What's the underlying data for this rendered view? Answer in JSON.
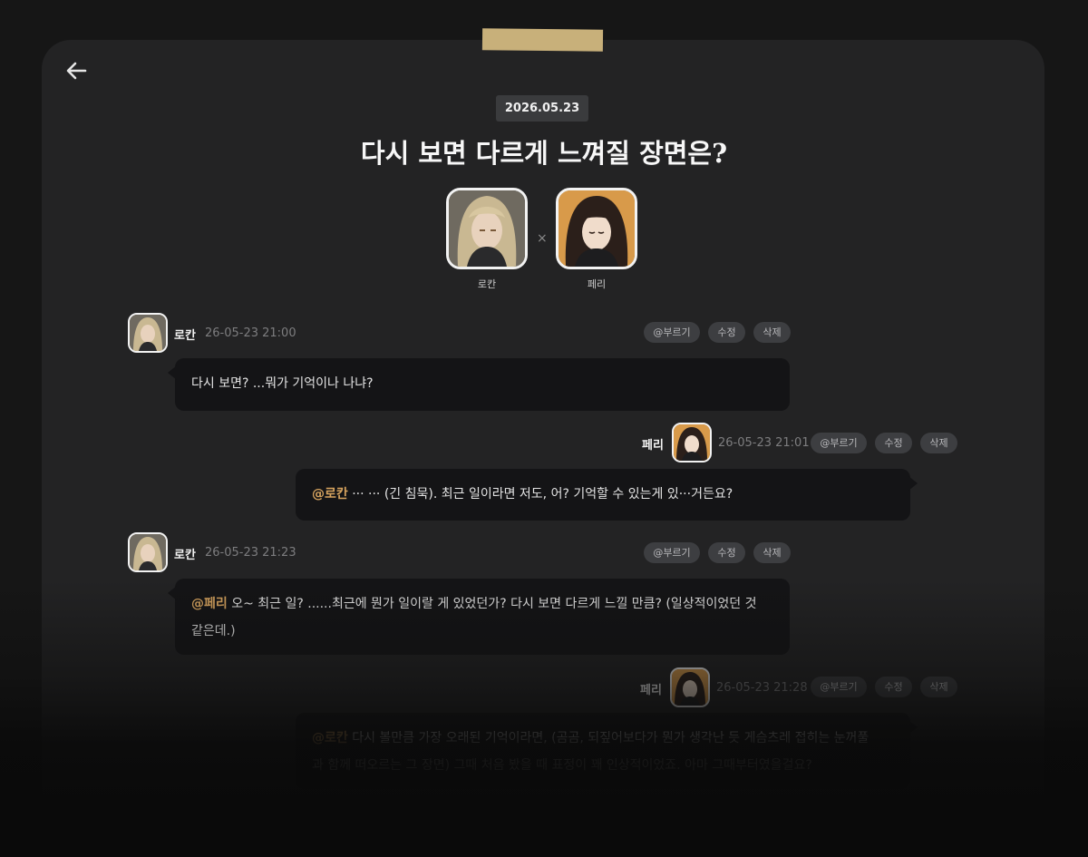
{
  "header": {
    "date": "2026.05.23",
    "title": "다시 보면 다르게 느껴질 장면은?"
  },
  "characters": [
    {
      "name": "로칸",
      "icon": "rokan-portrait"
    },
    {
      "name": "페리",
      "icon": "peri-portrait"
    }
  ],
  "separator": "×",
  "actions": {
    "call": "@부르기",
    "edit": "수정",
    "delete": "삭제"
  },
  "messages": [
    {
      "author": "로칸",
      "time": "26-05-23 21:00",
      "side": "left",
      "mention": "",
      "text": "다시 보면? ...뭐가 기억이나 나냐?"
    },
    {
      "author": "페리",
      "time": "26-05-23 21:01",
      "side": "right",
      "mention": "@로칸",
      "text": " ··· ··· (긴 침묵). 최근 일이라면 저도, 어? 기억할 수 있는게 있···거든요?"
    },
    {
      "author": "로칸",
      "time": "26-05-23 21:23",
      "side": "left",
      "mention": "@페리",
      "text_line1": " 오~ 최근 일? ......최근에 뭔가 일이랄 게 있었던가? 다시 보면 다르게 느낄 만큼? (일상적이었던 것",
      "text_line2": "같은데.)"
    },
    {
      "author": "페리",
      "time": "26-05-23 21:28",
      "side": "right",
      "mention": "@로칸",
      "text_line1": " 다시 볼만큼 가장 오래된 기억이라면, (곰곰, 되짚어보다가 뭔가 생각난 듯 게슴츠레 접히는 눈꺼풀",
      "text_line2": "과 함께 떠오르는 그 장면) 그때 처음 봤을 때 표정이 꽤 인상적이었죠. 아마 그때부터였을걸요?"
    }
  ],
  "colors": {
    "card": "#232324",
    "bubble": "#141416",
    "mention": "#d7a45f",
    "tape": "#c8b07a",
    "pill": "#3d3e41"
  }
}
